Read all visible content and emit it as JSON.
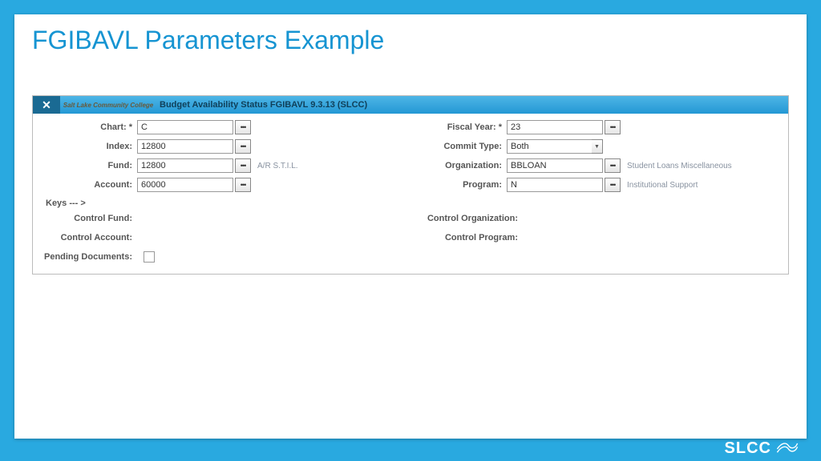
{
  "slide": {
    "title": "FGIBAVL Parameters Example"
  },
  "panel": {
    "title": "Budget Availability Status FGIBAVL 9.3.13 (SLCC)",
    "logo_text": "Salt Lake Community College"
  },
  "left": {
    "chart": {
      "label": "Chart: *",
      "value": "C"
    },
    "index": {
      "label": "Index:",
      "value": "12800"
    },
    "fund": {
      "label": "Fund:",
      "value": "12800",
      "desc": "A/R S.T.I.L."
    },
    "account": {
      "label": "Account:",
      "value": "60000"
    }
  },
  "right": {
    "fiscal_year": {
      "label": "Fiscal Year: *",
      "value": "23"
    },
    "commit_type": {
      "label": "Commit Type:",
      "value": "Both"
    },
    "organization": {
      "label": "Organization:",
      "value": "BBLOAN",
      "desc": "Student Loans Miscellaneous"
    },
    "program": {
      "label": "Program:",
      "value": "N",
      "desc": "Institutional Support"
    }
  },
  "keys": {
    "header": "Keys --- >",
    "control_fund": "Control Fund:",
    "control_account": "Control Account:",
    "control_organization": "Control Organization:",
    "control_program": "Control Program:",
    "pending_documents": "Pending Documents:"
  },
  "footer": {
    "brand": "SLCC"
  }
}
